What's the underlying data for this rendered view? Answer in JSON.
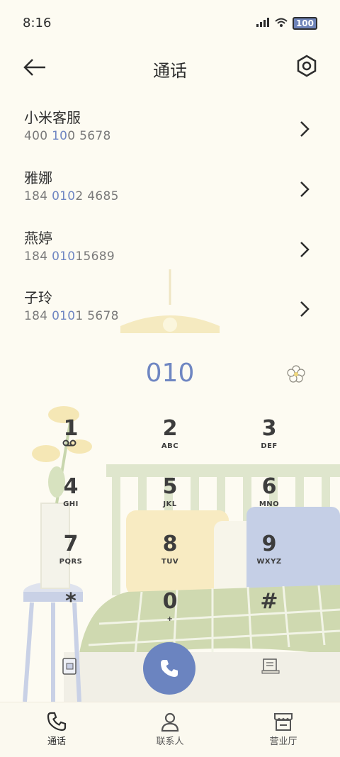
{
  "status_bar": {
    "time": "8:16",
    "battery": "100"
  },
  "header": {
    "title": "通话"
  },
  "contacts": [
    {
      "name": "小米客服",
      "number_parts": [
        {
          "t": "400 "
        },
        {
          "t": "10",
          "hl": true
        },
        {
          "t": "0 5678"
        }
      ]
    },
    {
      "name": "雅娜",
      "number_parts": [
        {
          "t": "184 "
        },
        {
          "t": "010",
          "hl": true
        },
        {
          "t": "2 4685"
        }
      ]
    },
    {
      "name": "燕婷",
      "number_parts": [
        {
          "t": "184 "
        },
        {
          "t": "010",
          "hl": true
        },
        {
          "t": "15689"
        }
      ]
    },
    {
      "name": "子玲",
      "number_parts": [
        {
          "t": "184 "
        },
        {
          "t": "010",
          "hl": true
        },
        {
          "t": "1 5678"
        }
      ]
    }
  ],
  "dialer": {
    "number": "010",
    "keys": [
      {
        "digit": "1",
        "sub": ""
      },
      {
        "digit": "2",
        "sub": "ABC"
      },
      {
        "digit": "3",
        "sub": "DEF"
      },
      {
        "digit": "4",
        "sub": "GHI"
      },
      {
        "digit": "5",
        "sub": "JKL"
      },
      {
        "digit": "6",
        "sub": "MNO"
      },
      {
        "digit": "7",
        "sub": "PQRS"
      },
      {
        "digit": "8",
        "sub": "TUV"
      },
      {
        "digit": "9",
        "sub": "WXYZ"
      },
      {
        "digit": "*",
        "sub": ""
      },
      {
        "digit": "0",
        "sub": "+"
      },
      {
        "digit": "#",
        "sub": ""
      }
    ]
  },
  "bottom_nav": {
    "items": [
      {
        "label": "通话"
      },
      {
        "label": "联系人"
      },
      {
        "label": "营业厅"
      }
    ]
  },
  "colors": {
    "accent": "#6f86c2",
    "background": "#fdfbf2"
  }
}
